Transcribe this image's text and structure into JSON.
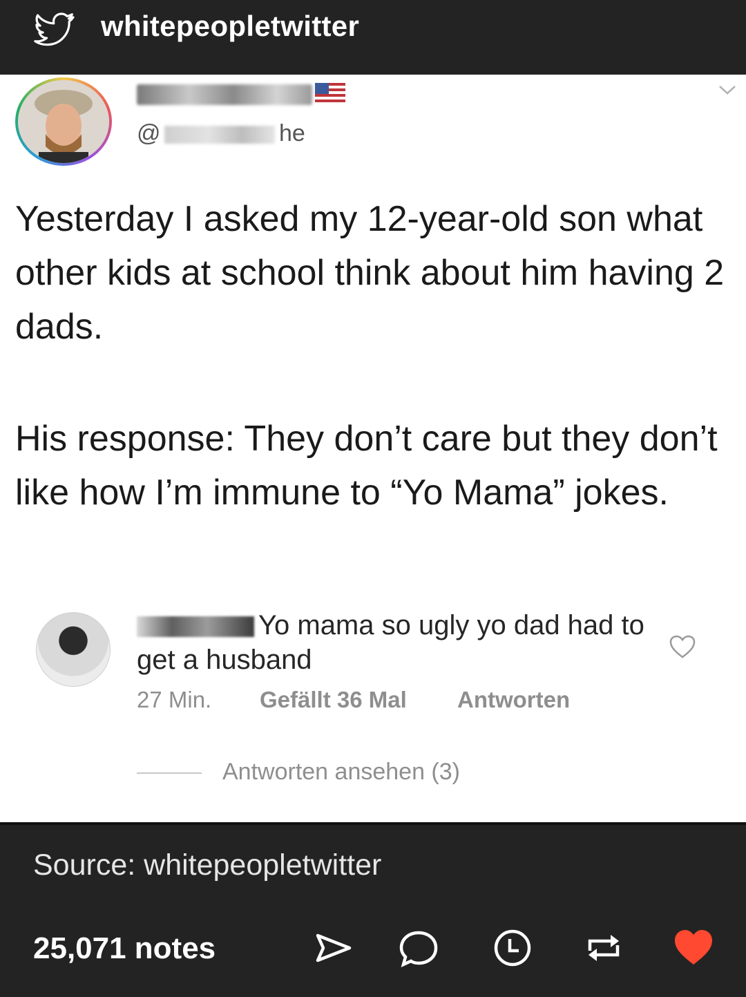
{
  "topbar": {
    "blog_name": "whitepeopletwitter",
    "icon": "twitter-bird-icon"
  },
  "tweet": {
    "handle_prefix": "@",
    "handle_suffix": "he",
    "paragraph1": "Yesterday I asked my 12-year-old son what other kids at school think about him having 2 dads.",
    "paragraph2": "His response: They don’t care but they don’t like how I’m immune to “Yo Mama” jokes."
  },
  "comment": {
    "text": "Yo mama so ugly yo dad had to get a husband",
    "time": "27 Min.",
    "likes": "Gefällt 36 Mal",
    "reply": "Antworten",
    "view_replies": "Antworten ansehen (3)"
  },
  "footer": {
    "source": "Source: whitepeopletwitter",
    "notes": "25,071 notes",
    "actions": [
      "share-icon",
      "reply-icon",
      "queue-icon",
      "reblog-icon",
      "like-heart-icon"
    ],
    "like_color": "#ff4930"
  }
}
